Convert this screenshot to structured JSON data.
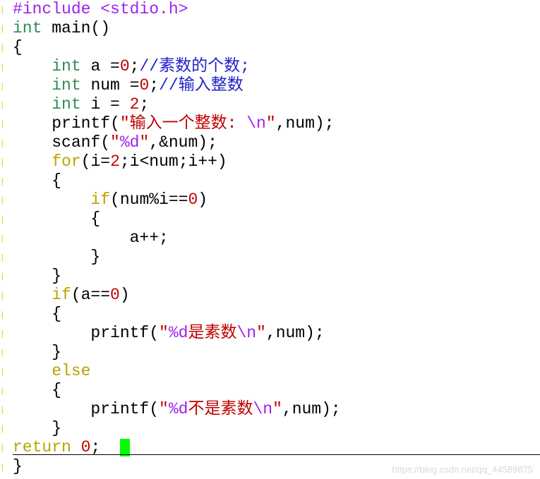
{
  "code_lines": [
    [
      {
        "t": "#include <stdio.h>",
        "c": "kw-pre"
      }
    ],
    [
      {
        "t": "int",
        "c": "kw-type"
      },
      {
        "t": " main()",
        "c": ""
      }
    ],
    [
      {
        "t": "{",
        "c": ""
      }
    ],
    [
      {
        "t": "    ",
        "c": ""
      },
      {
        "t": "int",
        "c": "kw-type"
      },
      {
        "t": " a =",
        "c": ""
      },
      {
        "t": "0",
        "c": "num"
      },
      {
        "t": ";",
        "c": ""
      },
      {
        "t": "//素数的个数;",
        "c": "cmt"
      }
    ],
    [
      {
        "t": "    ",
        "c": ""
      },
      {
        "t": "int",
        "c": "kw-type"
      },
      {
        "t": " num =",
        "c": ""
      },
      {
        "t": "0",
        "c": "num"
      },
      {
        "t": ";",
        "c": ""
      },
      {
        "t": "//输入整数",
        "c": "cmt"
      }
    ],
    [
      {
        "t": "    ",
        "c": ""
      },
      {
        "t": "int",
        "c": "kw-type"
      },
      {
        "t": " i = ",
        "c": ""
      },
      {
        "t": "2",
        "c": "num"
      },
      {
        "t": ";",
        "c": ""
      }
    ],
    [
      {
        "t": "    printf(",
        "c": ""
      },
      {
        "t": "\"输入一个整数: ",
        "c": "str"
      },
      {
        "t": "\\n",
        "c": "fmt"
      },
      {
        "t": "\"",
        "c": "str"
      },
      {
        "t": ",num);",
        "c": ""
      }
    ],
    [
      {
        "t": "    scanf(",
        "c": ""
      },
      {
        "t": "\"",
        "c": "str"
      },
      {
        "t": "%d",
        "c": "fmt"
      },
      {
        "t": "\"",
        "c": "str"
      },
      {
        "t": ",&num);",
        "c": ""
      }
    ],
    [
      {
        "t": "    ",
        "c": ""
      },
      {
        "t": "for",
        "c": "kw-ctrl"
      },
      {
        "t": "(i=",
        "c": ""
      },
      {
        "t": "2",
        "c": "num"
      },
      {
        "t": ";i<num;i++)",
        "c": ""
      }
    ],
    [
      {
        "t": "    {",
        "c": ""
      }
    ],
    [
      {
        "t": "        ",
        "c": ""
      },
      {
        "t": "if",
        "c": "kw-ctrl"
      },
      {
        "t": "(num%i==",
        "c": ""
      },
      {
        "t": "0",
        "c": "num"
      },
      {
        "t": ")",
        "c": ""
      }
    ],
    [
      {
        "t": "        {",
        "c": ""
      }
    ],
    [
      {
        "t": "            a++;",
        "c": ""
      }
    ],
    [
      {
        "t": "        }",
        "c": ""
      }
    ],
    [
      {
        "t": "    }",
        "c": ""
      }
    ],
    [
      {
        "t": "    ",
        "c": ""
      },
      {
        "t": "if",
        "c": "kw-ctrl"
      },
      {
        "t": "(a==",
        "c": ""
      },
      {
        "t": "0",
        "c": "num"
      },
      {
        "t": ")",
        "c": ""
      }
    ],
    [
      {
        "t": "    {",
        "c": ""
      }
    ],
    [
      {
        "t": "        printf(",
        "c": ""
      },
      {
        "t": "\"",
        "c": "str"
      },
      {
        "t": "%d",
        "c": "fmt"
      },
      {
        "t": "是素数",
        "c": "str"
      },
      {
        "t": "\\n",
        "c": "fmt"
      },
      {
        "t": "\"",
        "c": "str"
      },
      {
        "t": ",num);",
        "c": ""
      }
    ],
    [
      {
        "t": "    }",
        "c": ""
      }
    ],
    [
      {
        "t": "    ",
        "c": ""
      },
      {
        "t": "else",
        "c": "kw-ctrl"
      }
    ],
    [
      {
        "t": "    {",
        "c": ""
      }
    ],
    [
      {
        "t": "        printf(",
        "c": ""
      },
      {
        "t": "\"",
        "c": "str"
      },
      {
        "t": "%d",
        "c": "fmt"
      },
      {
        "t": "不是素数",
        "c": "str"
      },
      {
        "t": "\\n",
        "c": "fmt"
      },
      {
        "t": "\"",
        "c": "str"
      },
      {
        "t": ",num);",
        "c": ""
      }
    ],
    [
      {
        "t": "    }",
        "c": ""
      }
    ],
    [
      {
        "t": "return",
        "c": "kw-ctrl"
      },
      {
        "t": " ",
        "c": ""
      },
      {
        "t": "0",
        "c": "num"
      },
      {
        "t": ";  ",
        "c": ""
      }
    ],
    [
      {
        "t": "}",
        "c": ""
      }
    ]
  ],
  "cursor_line_index": 23,
  "watermark": "https://blog.csdn.net/qq_44589875",
  "colors": {
    "type_keyword": "#2e8b57",
    "control_keyword": "#b8a500",
    "preprocessor": "#a020f0",
    "string": "#c00000",
    "number": "#c00000",
    "comment": "#1f24c7",
    "cursor": "#00ff00"
  }
}
